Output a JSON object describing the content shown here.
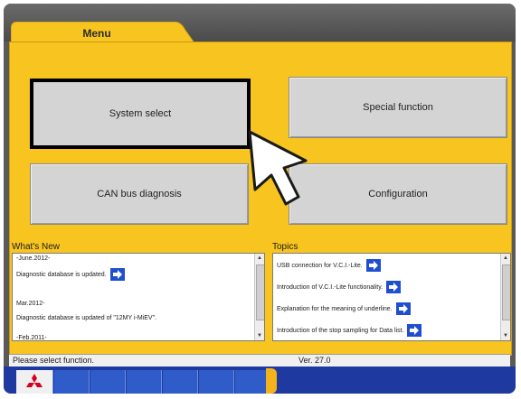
{
  "tab": {
    "label": "Menu"
  },
  "buttons": {
    "system_select": "System select",
    "special_function": "Special function",
    "can_bus": "CAN bus diagnosis",
    "configuration": "Configuration"
  },
  "whats_new": {
    "title": "What's New",
    "items": [
      "-June.2012-",
      "Diagnostic database is updated.",
      "Mar.2012-",
      "Diagnostic database is updated of \"12MY i-MiEV\".",
      "-Feb.2011-"
    ]
  },
  "topics": {
    "title": "Topics",
    "items": [
      "USB connection for V.C.I.-Lite.",
      "Introduction of V.C.I.-Lite functionality.",
      "Explanation for the meaning of underline.",
      "Introduction of the stop sampling for Data list."
    ]
  },
  "status": {
    "message": "Please select function.",
    "version": "Ver. 27.0"
  },
  "colors": {
    "panel": "#f7c420",
    "taskbar": "#1e3aa0",
    "brand": "#d6001c"
  },
  "icons": {
    "arrow": "arrow-right-icon",
    "logo": "mitsubishi-logo-icon",
    "pointer": "mouse-pointer-icon"
  }
}
